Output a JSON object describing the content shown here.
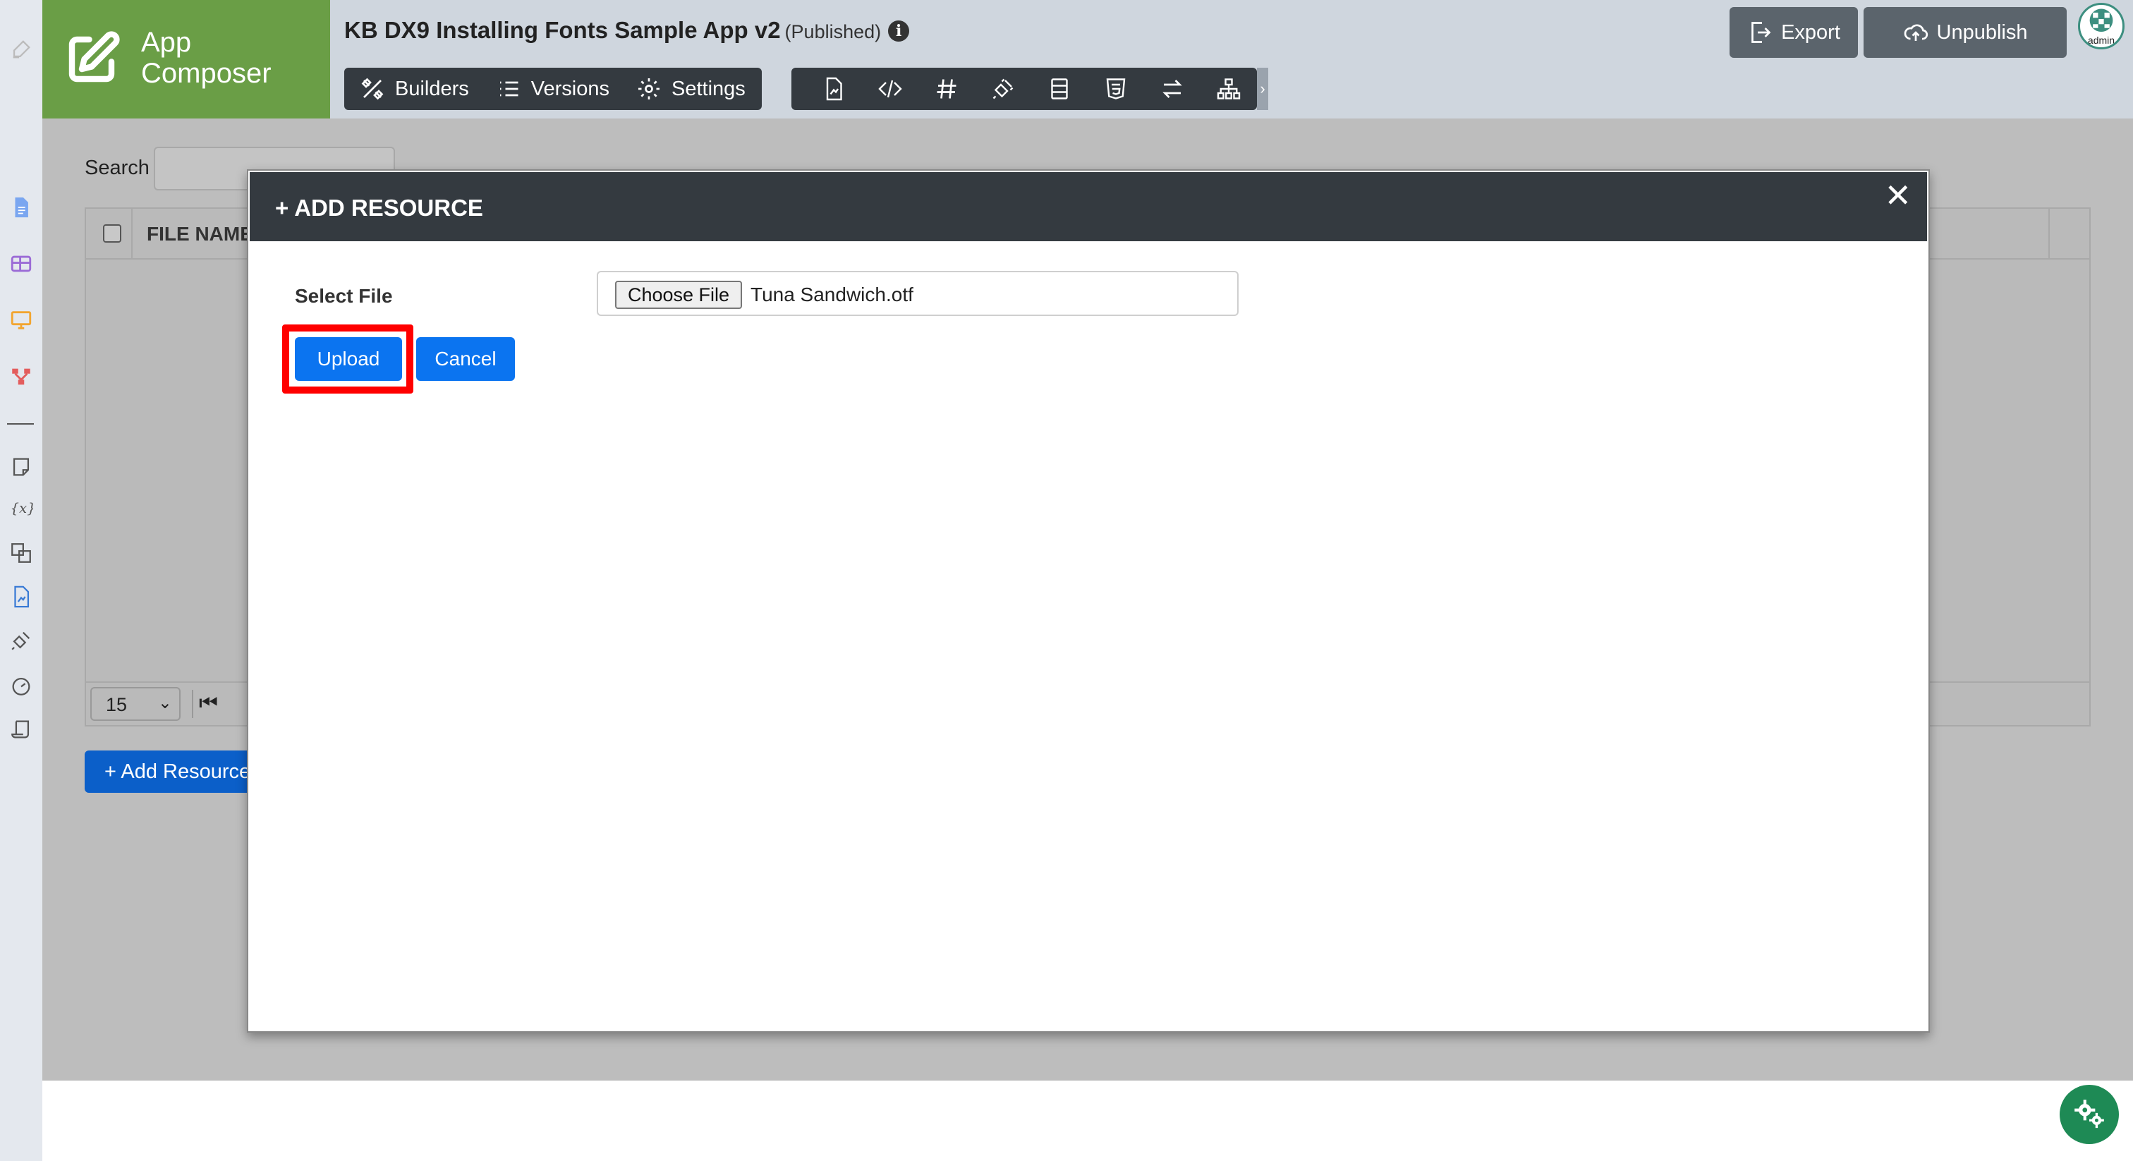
{
  "header": {
    "brand_line1": "App",
    "brand_line2": "Composer",
    "app_title": "KB DX9 Installing Fonts Sample App v2",
    "app_status": "(Published)",
    "info_glyph": "i",
    "nav": {
      "builders": "Builders",
      "versions": "Versions",
      "settings": "Settings"
    },
    "tools": [
      "page-icon",
      "code-icon",
      "hash-icon",
      "plugin-icon",
      "form-icon",
      "html5-icon",
      "swap-icon",
      "sitemap-icon"
    ],
    "export_label": "Export",
    "unpublish_label": "Unpublish",
    "avatar_label": "admin"
  },
  "sidebar": {
    "icons": [
      "document-icon",
      "table-icon",
      "monitor-icon",
      "workflow-icon",
      "note-icon",
      "variable-icon",
      "translate-icon",
      "report-icon",
      "plugin-icon",
      "gauge-icon",
      "scroll-icon"
    ]
  },
  "background": {
    "search_label": "Search",
    "table_header_file_name": "FILE NAME",
    "page_size": "15",
    "add_resource_label": "+ Add Resource"
  },
  "modal": {
    "title": "+ ADD RESOURCE",
    "close_glyph": "✕",
    "select_file_label": "Select File",
    "choose_file_label": "Choose File",
    "chosen_file_name": "Tuna Sandwich.otf",
    "upload_label": "Upload",
    "cancel_label": "Cancel",
    "highlighted_control": "Upload"
  },
  "colors": {
    "brand_green": "#6a9e46",
    "dark_bar": "#343a40",
    "primary_blue": "#0b74f0",
    "highlight_red": "#ff0000",
    "fab_green": "#1e8a55"
  }
}
